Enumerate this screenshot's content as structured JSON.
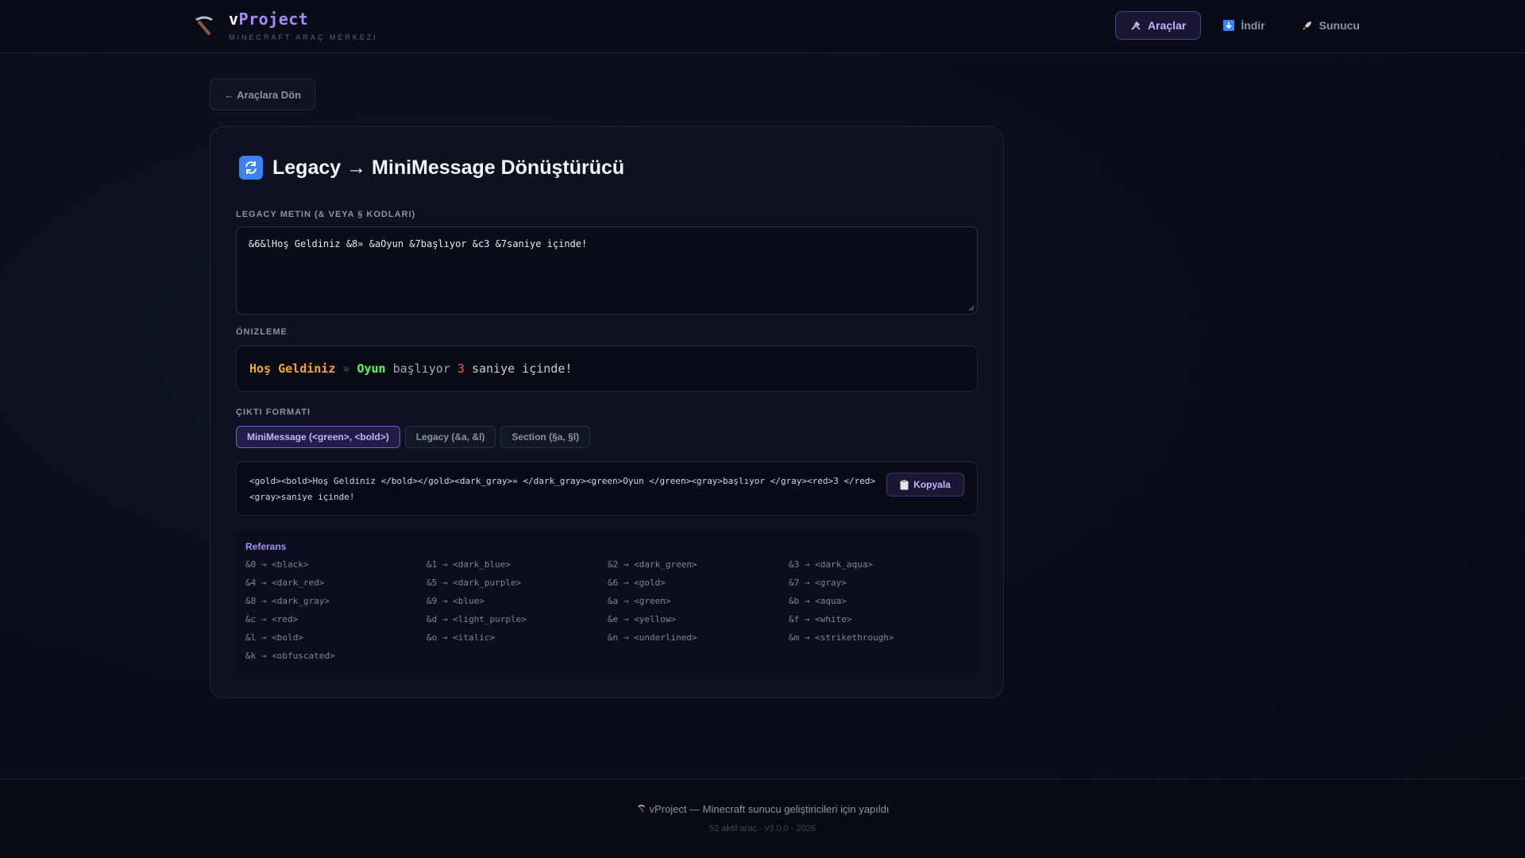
{
  "brand": {
    "title_prefix": "v",
    "title_accent": "Project",
    "subtitle": "MINECRAFT ARAÇ MERKEZI"
  },
  "nav": {
    "items": [
      {
        "label": "Araçlar",
        "icon": "tools-icon",
        "active": true
      },
      {
        "label": "İndir",
        "icon": "download-icon",
        "active": false
      },
      {
        "label": "Sunucu",
        "icon": "rocket-icon",
        "active": false
      }
    ]
  },
  "back_button": {
    "label": "← Araçlara Dön"
  },
  "tool": {
    "icon": "refresh-icon",
    "title": "Legacy → MiniMessage Dönüştürücü",
    "input_label": "LEGACY METIN (& VEYA § KODLARI)",
    "input_value": "&6&lHoş Geldiniz &8» &aOyun &7başlıyor &c3 &7saniye içinde!",
    "preview_label": "ÖNIZLEME",
    "preview_segments": [
      {
        "text": "Hoş Geldiniz",
        "color": "#f6a623",
        "bold": true
      },
      {
        "text": " » ",
        "color": "#5a5a5a",
        "bold": false
      },
      {
        "text": "Oyun",
        "color": "#55ff55",
        "bold": true
      },
      {
        "text": " başlıyor ",
        "color": "#aaaaaa",
        "bold": false
      },
      {
        "text": "3",
        "color": "#ff5555",
        "bold": false
      },
      {
        "text": " saniye içinde!",
        "color": "#cccccc",
        "bold": false
      }
    ],
    "format_label": "ÇIKTI FORMATI",
    "format_tabs": [
      {
        "label": "MiniMessage (<green>, <bold>)",
        "active": true
      },
      {
        "label": "Legacy (&a, &l)",
        "active": false
      },
      {
        "label": "Section (§a, §l)",
        "active": false
      }
    ],
    "output_value": "<gold><bold>Hoş Geldiniz </bold></gold><dark_gray>» </dark_gray><green>Oyun </green><gray>başlıyor </gray><red>3 </red><gray>saniye içinde!",
    "copy_label": "Kopyala",
    "copy_icon": "clipboard-icon"
  },
  "reference": {
    "title": "Referans",
    "items": [
      "&0 → <black>",
      "&1 → <dark_blue>",
      "&2 → <dark_green>",
      "&3 → <dark_aqua>",
      "&4 → <dark_red>",
      "&5 → <dark_purple>",
      "&6 → <gold>",
      "&7 → <gray>",
      "&8 → <dark_gray>",
      "&9 → <blue>",
      "&a → <green>",
      "&b → <aqua>",
      "&c → <red>",
      "&d → <light_purple>",
      "&e → <yellow>",
      "&f → <white>",
      "&l → <bold>",
      "&o → <italic>",
      "&n → <underlined>",
      "&m → <strikethrough>",
      "&k → <obfuscated>"
    ]
  },
  "footer": {
    "main": "vProject — Minecraft sunucu geliştiricileri için yapıldı",
    "icon": "pickaxe-icon",
    "sub": "52 aktif araç · v3.0.0 · 2026"
  },
  "colors": {
    "accent": "#a78bfa",
    "background": "#0b0f1c"
  }
}
